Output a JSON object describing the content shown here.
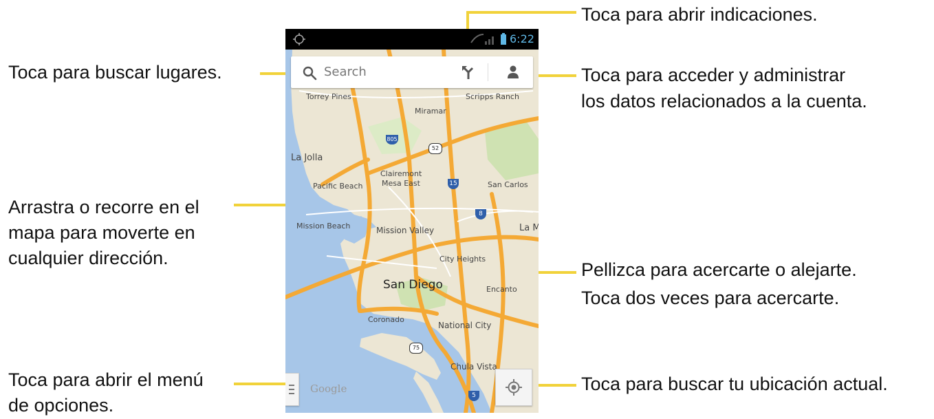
{
  "status_bar": {
    "time": "6:22"
  },
  "search": {
    "placeholder": "Search"
  },
  "map": {
    "labels": {
      "torrey_pines": "Torrey Pines",
      "scripps_ranch": "Scripps Ranch",
      "miramar": "Miramar",
      "la_jolla": "La Jolla",
      "clairemont": "Clairemont",
      "mesa_east": "Mesa East",
      "pacific_beach": "Pacific Beach",
      "san_carlos": "San Carlos",
      "mission_beach": "Mission Beach",
      "mission_valley": "Mission Valley",
      "la_mesa": "La M",
      "city_heights": "City Heights",
      "san_diego": "San Diego",
      "encanto": "Encanto",
      "coronado": "Coronado",
      "national_city": "National City",
      "chula_vista": "Chula Vista",
      "google": "Google"
    },
    "shields": {
      "i805": "805",
      "r52": "52",
      "i15": "15",
      "i8": "8",
      "r75": "75",
      "i5": "5"
    }
  },
  "callouts": {
    "search_places": "Toca para buscar lugares.",
    "directions": "Toca para abrir indicaciones.",
    "account_line1": "Toca para acceder y administrar",
    "account_line2": "los datos relacionados a la cuenta.",
    "drag_line1": "Arrastra o recorre en el",
    "drag_line2": "mapa para moverte en",
    "drag_line3": "cualquier dirección.",
    "pinch_line1": "Pellizca para acercarte o alejarte.",
    "pinch_line2": "Toca dos veces para acercarte.",
    "menu_line1": "Toca para abrir el menú",
    "menu_line2": "de opciones.",
    "location": "Toca para buscar tu ubicación actual."
  },
  "colors": {
    "leader": "#f1d23a",
    "water": "#a7c6e8",
    "land": "#ece6d4",
    "highway": "#f4a935"
  }
}
